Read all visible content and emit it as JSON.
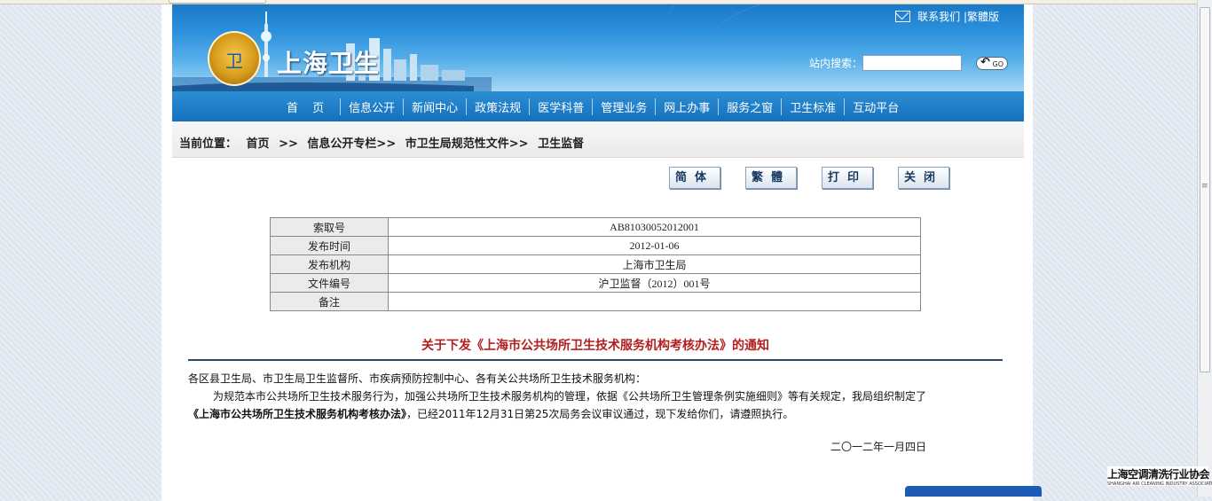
{
  "site": {
    "title": "上海卫生",
    "emblem_text": "卫"
  },
  "top_links": {
    "contact": "联系我们",
    "separator": "|",
    "traditional": "繁體版"
  },
  "search": {
    "label": "站内搜索：",
    "value": "",
    "go_label": "GO"
  },
  "nav": {
    "items": [
      "首 页",
      "信息公开",
      "新闻中心",
      "政策法规",
      "医学科普",
      "管理业务",
      "网上办事",
      "服务之窗",
      "卫生标准",
      "互动平台"
    ]
  },
  "breadcrumb": {
    "label": "当前位置：",
    "items": [
      "首页",
      ">>",
      "信息公开专栏>>",
      "市卫生局规范性文件>>",
      "卫生监督"
    ]
  },
  "actions": {
    "simplified": "简体",
    "traditional": "繁體",
    "print": "打印",
    "close": "关闭"
  },
  "meta": {
    "rows": [
      {
        "key": "索取号",
        "value": "AB81030052012001"
      },
      {
        "key": "发布时间",
        "value": "2012-01-06"
      },
      {
        "key": "发布机构",
        "value": "上海市卫生局"
      },
      {
        "key": "文件编号",
        "value": "沪卫监督（2012）001号"
      },
      {
        "key": "备注",
        "value": ""
      }
    ]
  },
  "article": {
    "title": "关于下发《上海市公共场所卫生技术服务机构考核办法》的通知",
    "salutation": "各区县卫生局、市卫生局卫生监督所、市疾病预防控制中心、各有关公共场所卫生技术服务机构：",
    "para1": "为规范本市公共场所卫生技术服务行为，加强公共场所卫生技术服务机构的管理，依据《公共场所卫生管理条例实施细则》等有关规定，我局组织制定了",
    "para2_bold": "《上海市公共场所卫生技术服务机构考核办法》",
    "para2_rest": "，已经2011年12月31日第25次局务会议审议通过，现下发给你们，请遵照执行。",
    "date": "二〇一二年一月四日"
  },
  "corner_logo": {
    "cn": "上海空调清洗行业协会",
    "en": "SHANGHAI AIR CLEANING INDUSTRY ASSOCIATION"
  },
  "colors": {
    "header_blue": "#1a79c8",
    "nav_blue": "#1670be",
    "title_red": "#b1201f"
  }
}
